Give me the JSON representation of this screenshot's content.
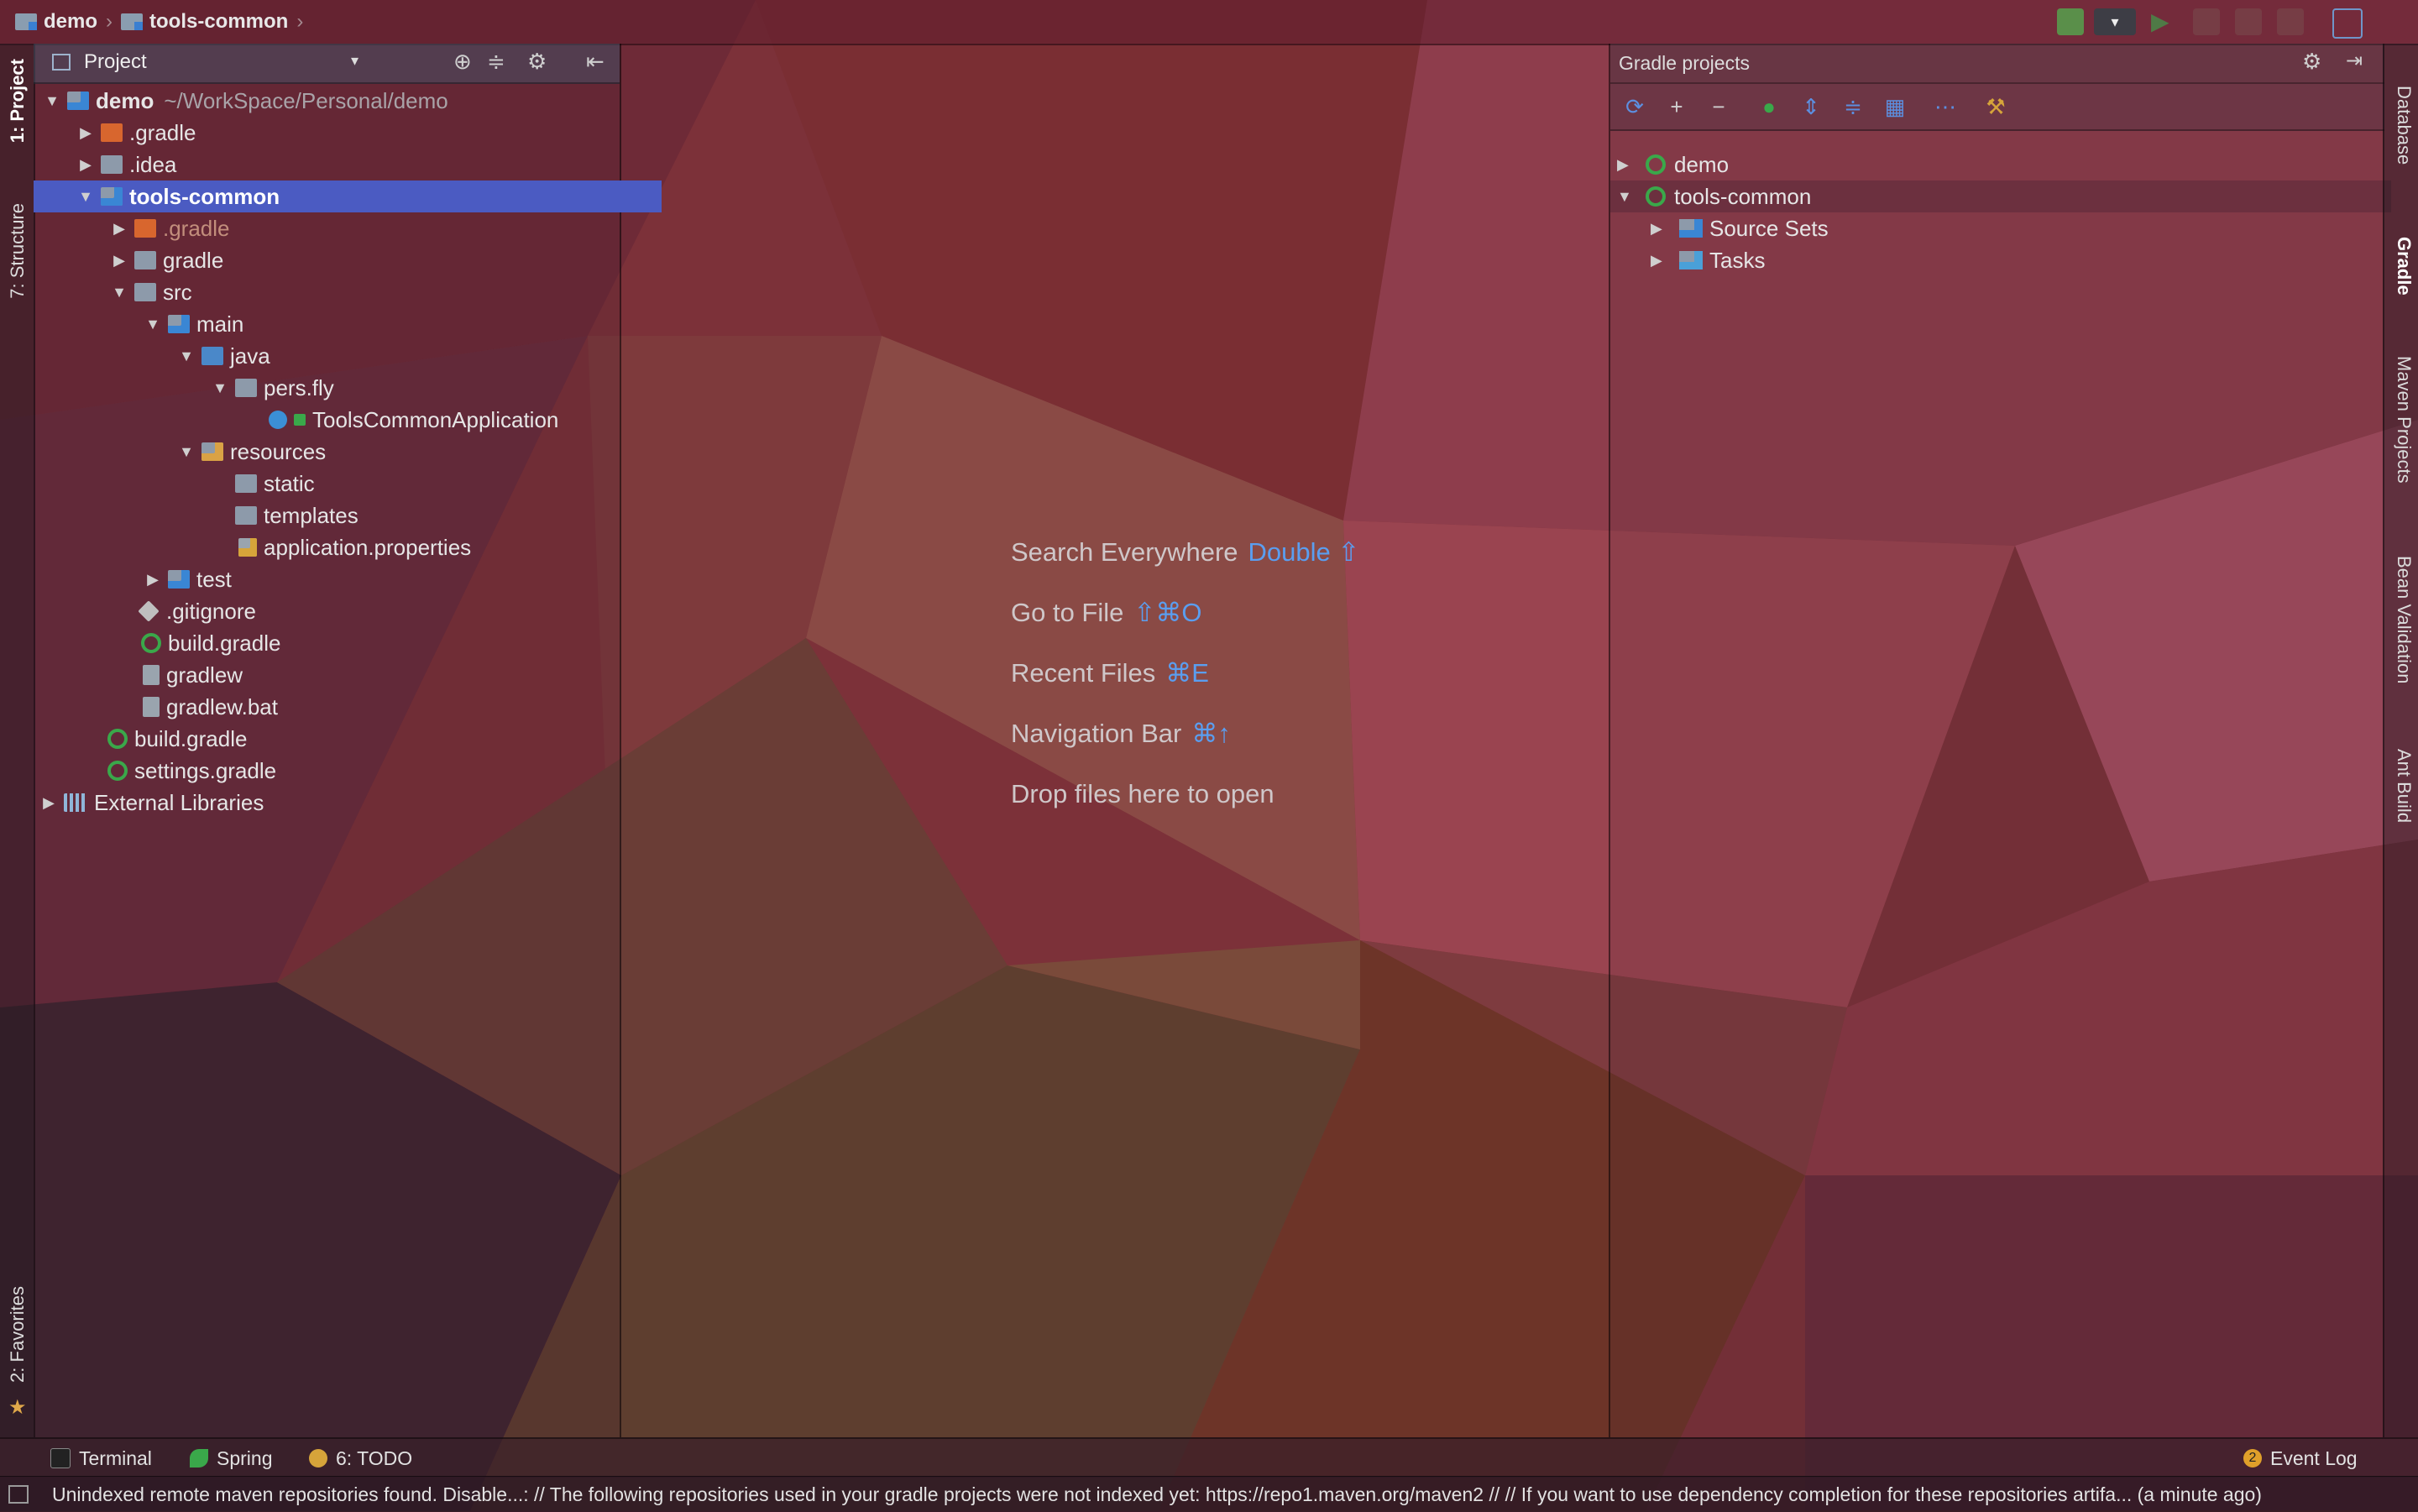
{
  "colors": {
    "selection": "#4b5bc2",
    "link_key": "#5a9ef0",
    "gradle_green": "#3aa84a"
  },
  "navbar": {
    "crumbs": [
      "demo",
      "tools-common"
    ]
  },
  "left_strip": {
    "tabs": [
      "1: Project",
      "7: Structure",
      "2: Favorites"
    ]
  },
  "right_strip": {
    "tabs": [
      "Database",
      "Gradle",
      "Maven Projects",
      "Bean Validation",
      "Ant Build"
    ]
  },
  "project_panel": {
    "title": "Project",
    "tree": [
      {
        "label": "demo",
        "path": "~/WorkSpace/Personal/demo"
      },
      {
        "label": ".gradle"
      },
      {
        "label": ".idea"
      },
      {
        "label": "tools-common"
      },
      {
        "label": ".gradle"
      },
      {
        "label": "gradle"
      },
      {
        "label": "src"
      },
      {
        "label": "main"
      },
      {
        "label": "java"
      },
      {
        "label": "pers.fly"
      },
      {
        "label": "ToolsCommonApplication"
      },
      {
        "label": "resources"
      },
      {
        "label": "static"
      },
      {
        "label": "templates"
      },
      {
        "label": "application.properties"
      },
      {
        "label": "test"
      },
      {
        "label": ".gitignore"
      },
      {
        "label": "build.gradle"
      },
      {
        "label": "gradlew"
      },
      {
        "label": "gradlew.bat"
      },
      {
        "label": "build.gradle"
      },
      {
        "label": "settings.gradle"
      },
      {
        "label": "External Libraries"
      }
    ]
  },
  "editor": {
    "hints": [
      {
        "label": "Search Everywhere",
        "key": "Double ⇧"
      },
      {
        "label": "Go to File",
        "key": "⇧⌘O"
      },
      {
        "label": "Recent Files",
        "key": "⌘E"
      },
      {
        "label": "Navigation Bar",
        "key": "⌘↑"
      },
      {
        "label": "Drop files here to open",
        "key": ""
      }
    ]
  },
  "gradle_panel": {
    "title": "Gradle projects",
    "tree": [
      {
        "label": "demo"
      },
      {
        "label": "tools-common"
      },
      {
        "label": "Source Sets"
      },
      {
        "label": "Tasks"
      }
    ]
  },
  "bottom_tabs": {
    "terminal": "Terminal",
    "spring": "Spring",
    "todo": "6: TODO",
    "event_log": "Event Log",
    "event_count": "2"
  },
  "status": {
    "message": "Unindexed remote maven repositories found. Disable...: // The following repositories used in your gradle projects were not indexed yet: https://repo1.maven.org/maven2 // // If you want to use dependency completion for these repositories artifa... (a minute ago)"
  }
}
